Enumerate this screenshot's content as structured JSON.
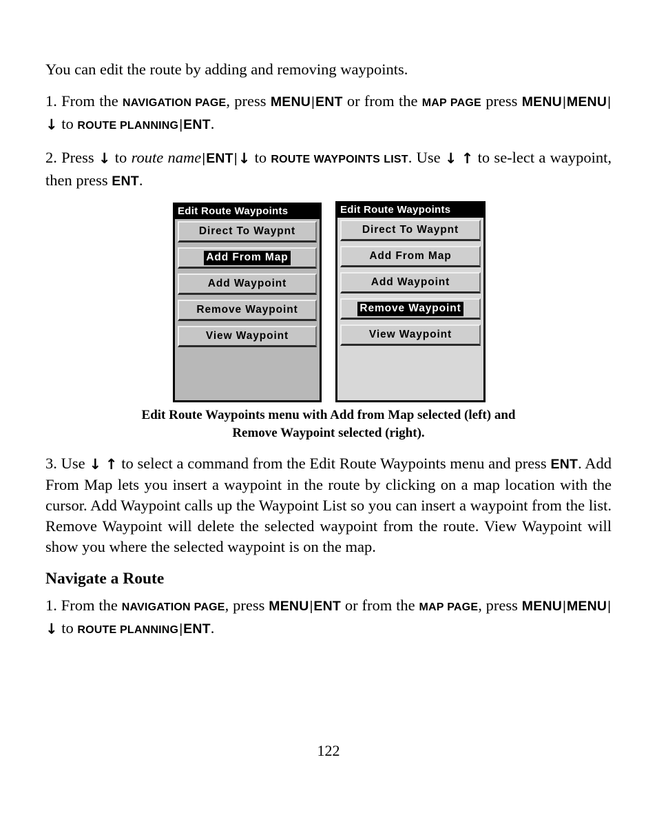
{
  "document": {
    "page_number": "122"
  },
  "intro": {
    "text": "You can edit the route by adding and removing waypoints."
  },
  "step1": {
    "number": "1.",
    "t1": "From the",
    "page_nav": "Navigation Page",
    "t2": ", press",
    "key_menu": "MENU",
    "sep": "|",
    "key_ent": "ENT",
    "t3": "or from the",
    "page_map": "Map Page",
    "t4": "press",
    "key_menu2": "MENU",
    "key_menu3": "MENU",
    "arrow_down": "↓",
    "t5": "to",
    "page_route_planning": "Route Planning",
    "key_ent2": "ENT",
    "period": "."
  },
  "step2": {
    "number": "2.",
    "t1": "Press",
    "arrow_down": "↓",
    "t2": "to",
    "route_name": "route name",
    "sep": "|",
    "key_ent": "ENT",
    "arrow_down2": "↓",
    "t3": "to",
    "route_waypoints_list": "Route Waypoints List",
    "t4": ". Use",
    "arrow_down3": "↓",
    "arrow_up": "↑",
    "t5": "to se-lect a waypoint, then press",
    "key_ent2": "ENT",
    "period": "."
  },
  "figure": {
    "left_screen": {
      "title": "Edit Route Waypoints",
      "items": [
        {
          "label": "Direct To Waypnt",
          "selected": false
        },
        {
          "label": "Add From Map",
          "selected": true
        },
        {
          "label": "Add Waypoint",
          "selected": false
        },
        {
          "label": "Remove Waypoint",
          "selected": false
        },
        {
          "label": "View Waypoint",
          "selected": false
        }
      ]
    },
    "right_screen": {
      "title": "Edit Route Waypoints",
      "items": [
        {
          "label": "Direct To Waypnt",
          "selected": false
        },
        {
          "label": "Add From Map",
          "selected": false
        },
        {
          "label": "Add Waypoint",
          "selected": false
        },
        {
          "label": "Remove Waypoint",
          "selected": true
        },
        {
          "label": "View Waypoint",
          "selected": false
        }
      ]
    },
    "caption_line1": "Edit Route Waypoints menu with Add from Map selected (left) and",
    "caption_line2": "Remove Waypoint selected (right)."
  },
  "step3": {
    "number": "3.",
    "t1": "Use",
    "arrow_down": "↓",
    "arrow_up": "↑",
    "t2": "to select a command from the Edit Route Waypoints menu and press",
    "key_ent": "ENT",
    "t3": ". Add From Map lets you insert a waypoint in the route by clicking on a map location with the cursor. Add Waypoint calls up the Waypoint List so you can insert a waypoint from the list. Remove Waypoint will delete the selected waypoint from the route. View Waypoint will show you where the selected waypoint is on the map."
  },
  "section": {
    "heading": "Navigate a Route"
  },
  "step4": {
    "number": "1.",
    "t1": "From the",
    "page_nav": "Navigation Page",
    "t2": ", press",
    "key_menu": "MENU",
    "sep": "|",
    "key_ent": "ENT",
    "t3": "or from the",
    "page_map": "Map Page",
    "t4": ", press",
    "key_menu2": "MENU",
    "key_menu3": "MENU",
    "arrow_down": "↓",
    "t5": "to",
    "page_route_planning": "Route Planning",
    "key_ent2": "ENT",
    "period": "."
  }
}
